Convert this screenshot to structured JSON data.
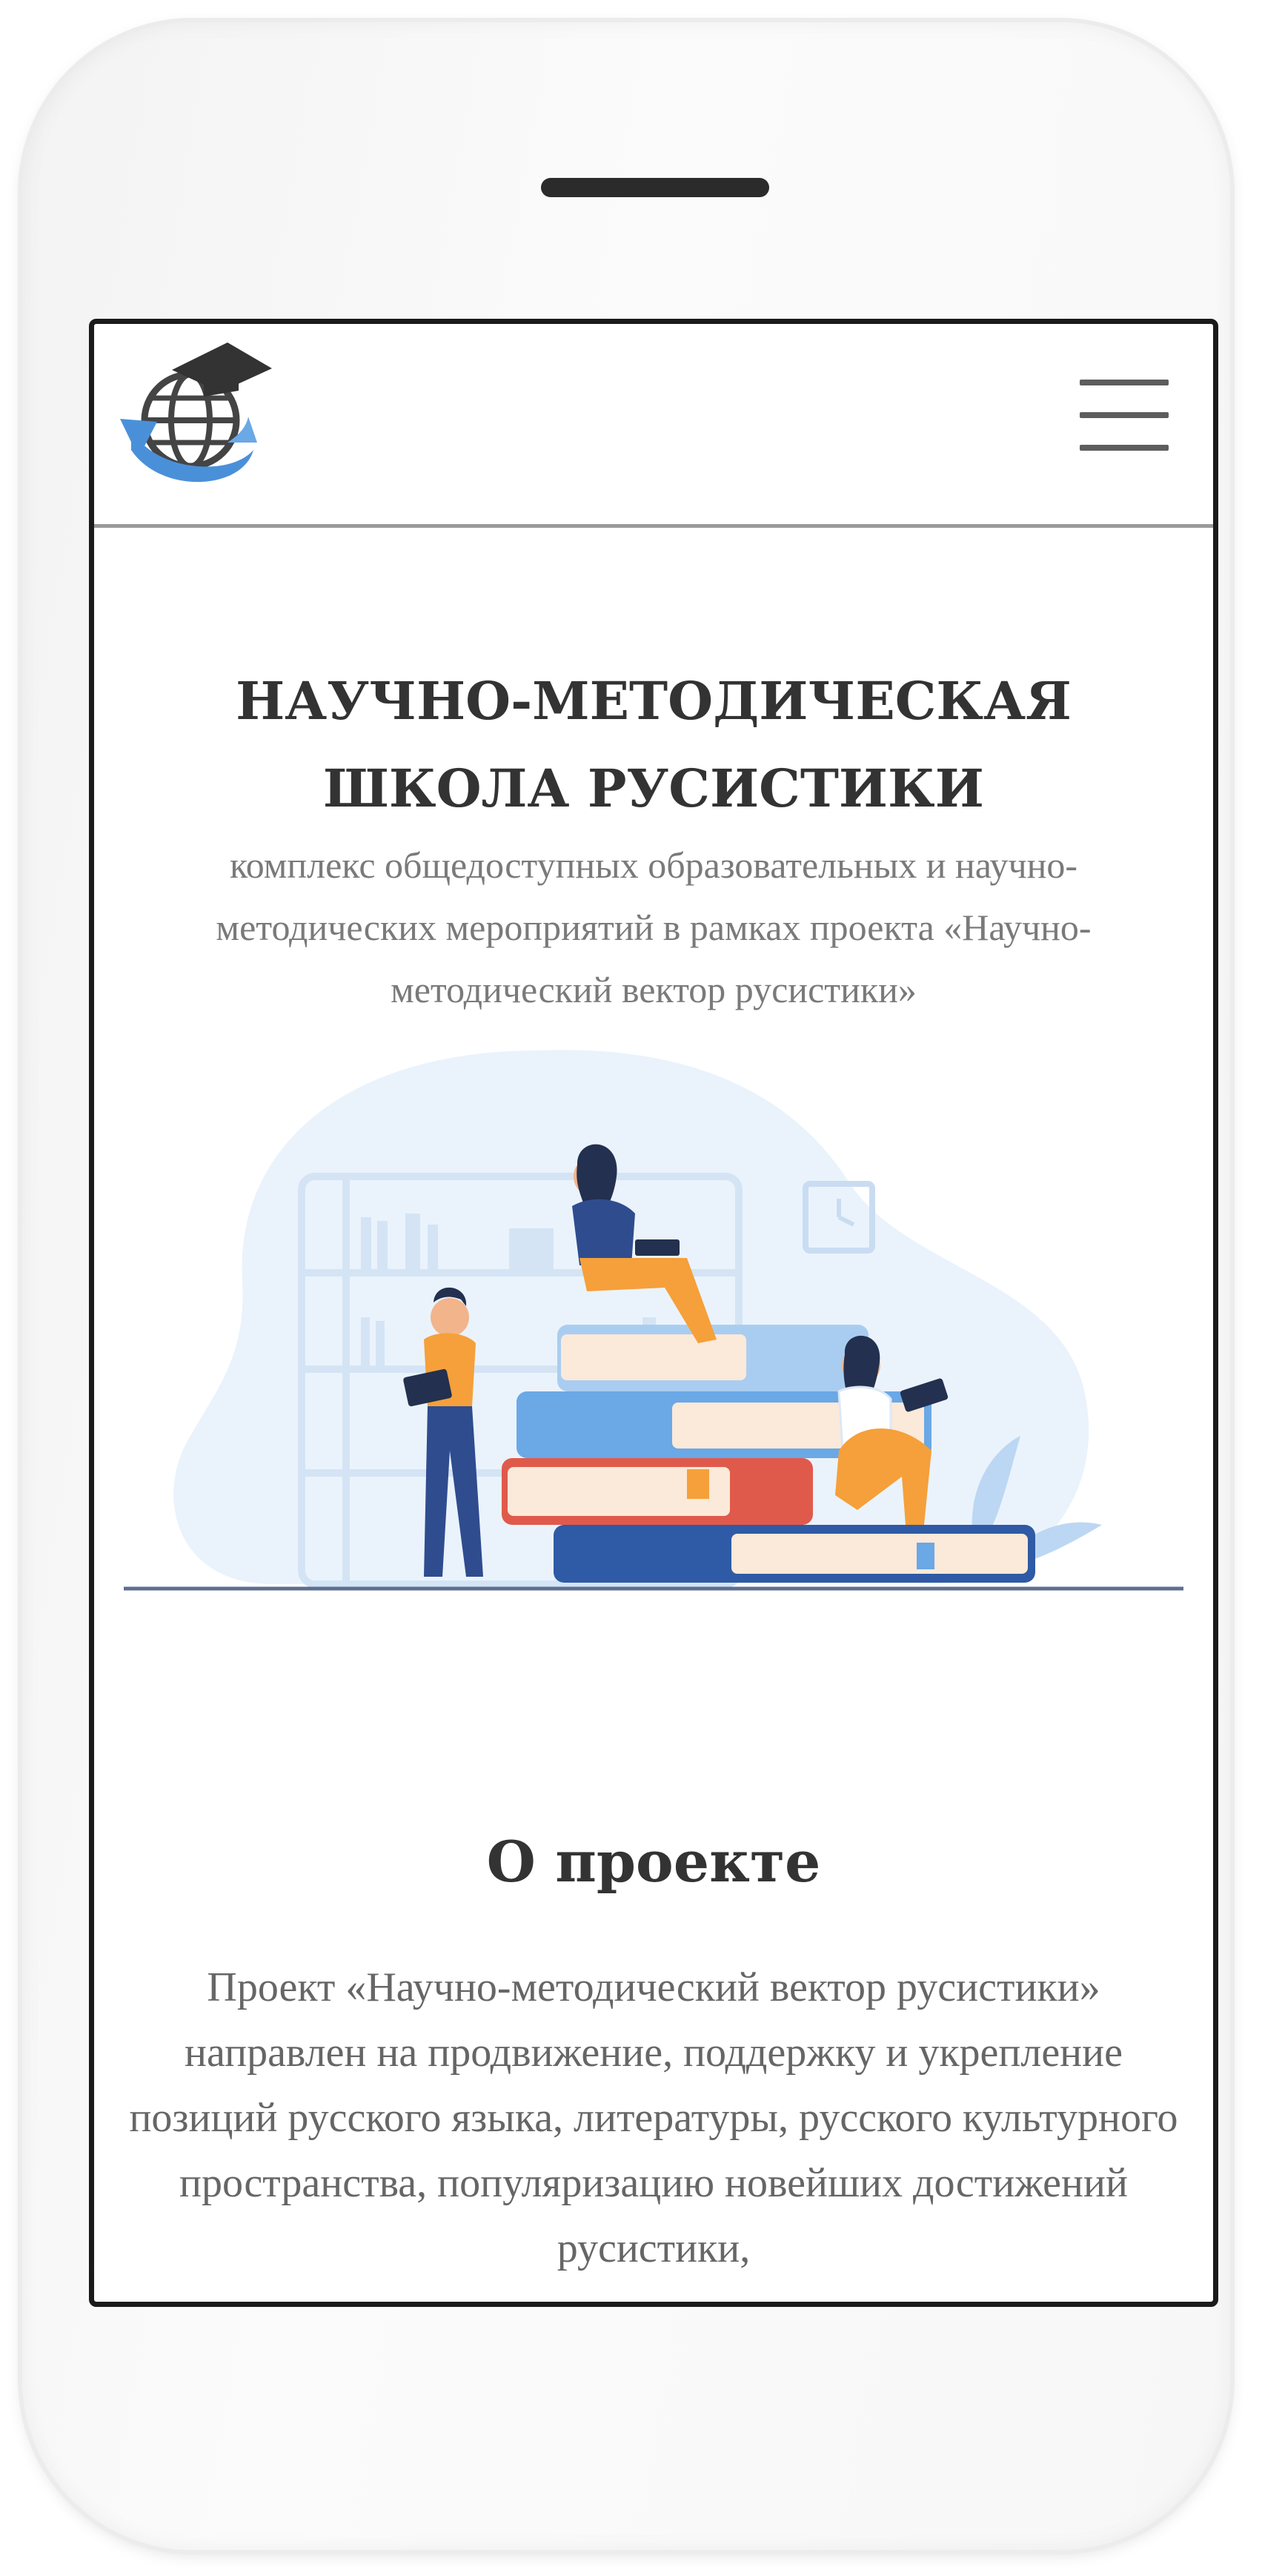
{
  "header": {
    "logo_icon": "globe-graduation-cap-logo",
    "menu_icon": "hamburger-menu-icon"
  },
  "hero": {
    "title": "НАУЧНО-МЕТОДИЧЕСКАЯ ШКОЛА РУСИСТИКИ",
    "subtitle": "комплекс общедоступных образовательных и научно-методических мероприятий в рамках проекта «Научно-методический вектор русистики»",
    "illustration": "people-reading-on-stack-of-books"
  },
  "about": {
    "heading": "О проекте",
    "text": "Проект «Научно-методический вектор русистики» направлен на продвижение, поддержку и укрепление позиций русского языка, литературы, русского культурного пространства, популяризацию новейших достижений русистики,"
  },
  "colors": {
    "title": "#333333",
    "subtitle": "#7a7a7a",
    "accent_blue": "#4a90d9",
    "accent_orange": "#f5a03a"
  }
}
